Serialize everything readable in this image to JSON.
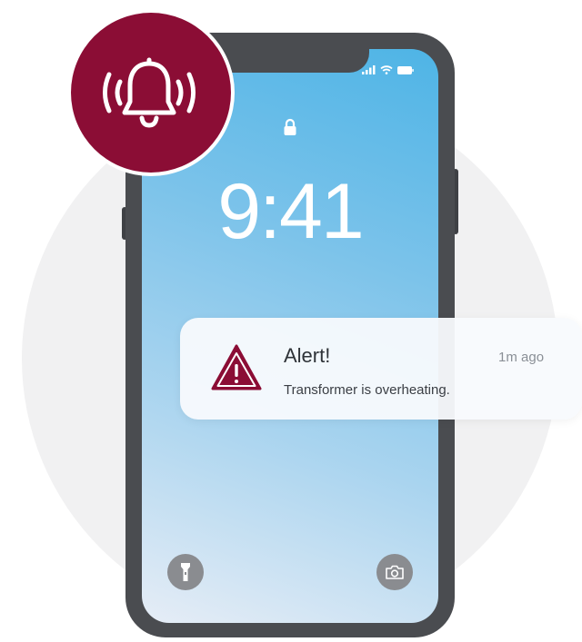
{
  "lockscreen": {
    "time": "9:41"
  },
  "notification": {
    "title": "Alert!",
    "time_ago": "1m ago",
    "message": "Transformer is overheating."
  },
  "icons": {
    "badge": "alarm-bell-icon",
    "notification": "warning-triangle-icon",
    "lock": "lock-icon",
    "left_button": "flashlight-icon",
    "right_button": "camera-icon",
    "status": [
      "signal-icon",
      "wifi-icon",
      "battery-icon"
    ]
  },
  "colors": {
    "brand": "#8b0d35",
    "phone_frame": "#4a4c50",
    "screen_top": "#4eb4e6",
    "screen_bottom": "#e6edf6"
  }
}
